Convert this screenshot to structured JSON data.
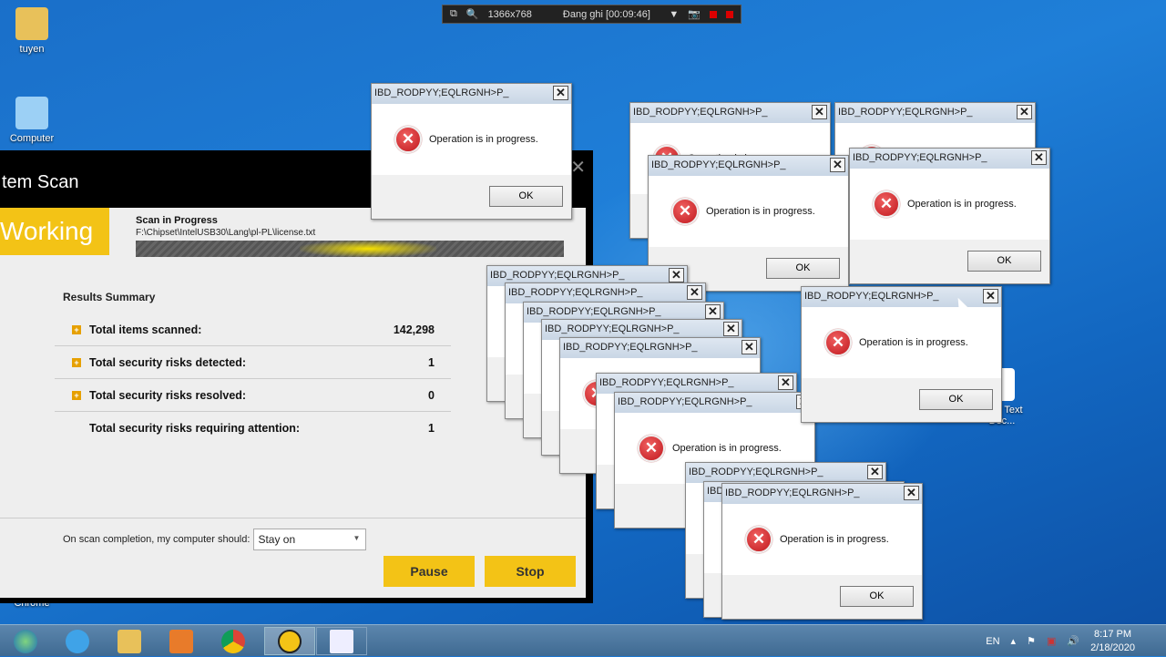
{
  "recorder": {
    "resolution": "1366x768",
    "status": "Đang ghi [00:09:46]"
  },
  "desktop": {
    "icons": [
      "tuyen",
      "Computer",
      "Chrome",
      "New Text Doc..."
    ]
  },
  "scan_window": {
    "title": "tem Scan",
    "state": "Working",
    "progress_label": "Scan in Progress",
    "current_file": "F:\\Chipset\\IntelUSB30\\Lang\\pl-PL\\license.txt",
    "results_title": "Results Summary",
    "results": [
      {
        "label": "Total items scanned:",
        "value": "142,298"
      },
      {
        "label": "Total security risks detected:",
        "value": "1"
      },
      {
        "label": "Total security risks resolved:",
        "value": "0"
      },
      {
        "label": "Total security risks requiring attention:",
        "value": "1"
      }
    ],
    "completion_label": "On scan completion, my computer should:",
    "completion_value": "Stay on",
    "pause": "Pause",
    "stop": "Stop"
  },
  "dialog": {
    "title": "IBD_RODPYY;EQLRGNH>P_",
    "message": "Operation is in progress.",
    "ok": "OK"
  },
  "taskbar": {
    "lang": "EN",
    "time": "8:17 PM",
    "date": "2/18/2020"
  }
}
